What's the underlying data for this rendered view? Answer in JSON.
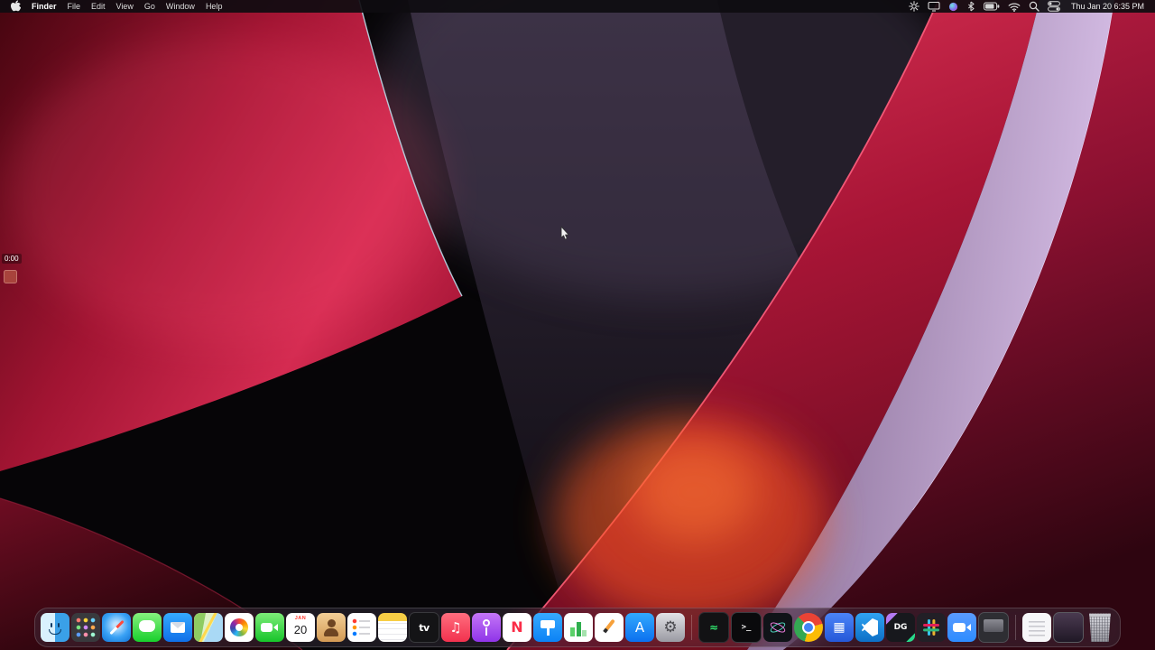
{
  "menubar": {
    "app_menu": "Finder",
    "menus": [
      "File",
      "Edit",
      "View",
      "Go",
      "Window",
      "Help"
    ],
    "status_icons": [
      "gear-icon",
      "display-icon",
      "siri-icon",
      "bluetooth-icon",
      "battery-icon",
      "wifi-icon",
      "spotlight-icon",
      "control-center-icon"
    ],
    "clock": "Thu Jan 20 6:35 PM"
  },
  "recorder": {
    "elapsed": "0:00"
  },
  "wallpaper": {
    "name": "macOS dark abstract red-purple waves",
    "colors": {
      "red": "#c41a3c",
      "purple": "#3a2f42",
      "lavender": "#cbb0dc",
      "orange": "#ff5a22",
      "base": "#060507"
    }
  },
  "dock": {
    "items": [
      {
        "id": "finder",
        "label": "Finder",
        "glyph": ""
      },
      {
        "id": "launchpad",
        "label": "Launchpad",
        "glyph": ""
      },
      {
        "id": "safari",
        "label": "Safari",
        "glyph": ""
      },
      {
        "id": "messages",
        "label": "Messages",
        "glyph": ""
      },
      {
        "id": "mail",
        "label": "Mail",
        "glyph": ""
      },
      {
        "id": "maps",
        "label": "Maps",
        "glyph": ""
      },
      {
        "id": "photos",
        "label": "Photos",
        "glyph": ""
      },
      {
        "id": "facetime",
        "label": "FaceTime",
        "glyph": ""
      },
      {
        "id": "calendar",
        "label": "Calendar",
        "month": "JAN",
        "day": "20"
      },
      {
        "id": "contacts",
        "label": "Contacts",
        "glyph": ""
      },
      {
        "id": "reminders",
        "label": "Reminders",
        "glyph": ""
      },
      {
        "id": "notes",
        "label": "Notes",
        "glyph": ""
      },
      {
        "id": "apple-tv",
        "label": "Apple TV",
        "glyph": "tv"
      },
      {
        "id": "music",
        "label": "Music",
        "glyph": "♫"
      },
      {
        "id": "podcasts",
        "label": "Podcasts",
        "glyph": ""
      },
      {
        "id": "news",
        "label": "News",
        "glyph": "N"
      },
      {
        "id": "keynote",
        "label": "Keynote",
        "glyph": ""
      },
      {
        "id": "numbers",
        "label": "Numbers",
        "glyph": ""
      },
      {
        "id": "pages",
        "label": "Pages",
        "glyph": ""
      },
      {
        "id": "app-store",
        "label": "App Store",
        "glyph": "A"
      },
      {
        "id": "settings",
        "label": "System Preferences",
        "glyph": "⚙"
      },
      {
        "id": "monitor",
        "label": "Activity monitor app",
        "glyph": "≈"
      },
      {
        "id": "terminal",
        "label": "Terminal",
        "glyph": ">_"
      },
      {
        "id": "atom",
        "label": "Atom-style dev app",
        "glyph": ""
      },
      {
        "id": "chrome",
        "label": "Google Chrome",
        "glyph": ""
      },
      {
        "id": "grid-app",
        "label": "Blue grid app",
        "glyph": "▦"
      },
      {
        "id": "vscode",
        "label": "Visual Studio Code",
        "glyph": ""
      },
      {
        "id": "datagrip",
        "label": "DataGrip",
        "glyph": "DG"
      },
      {
        "id": "slack",
        "label": "Slack",
        "glyph": ""
      },
      {
        "id": "zoom",
        "label": "Zoom",
        "glyph": ""
      },
      {
        "id": "screen-app",
        "label": "Screen window app",
        "glyph": ""
      },
      {
        "id": "document",
        "label": "Document stack",
        "glyph": ""
      },
      {
        "id": "min-window",
        "label": "Minimized window",
        "glyph": ""
      },
      {
        "id": "trash",
        "label": "Trash",
        "glyph": ""
      }
    ]
  }
}
